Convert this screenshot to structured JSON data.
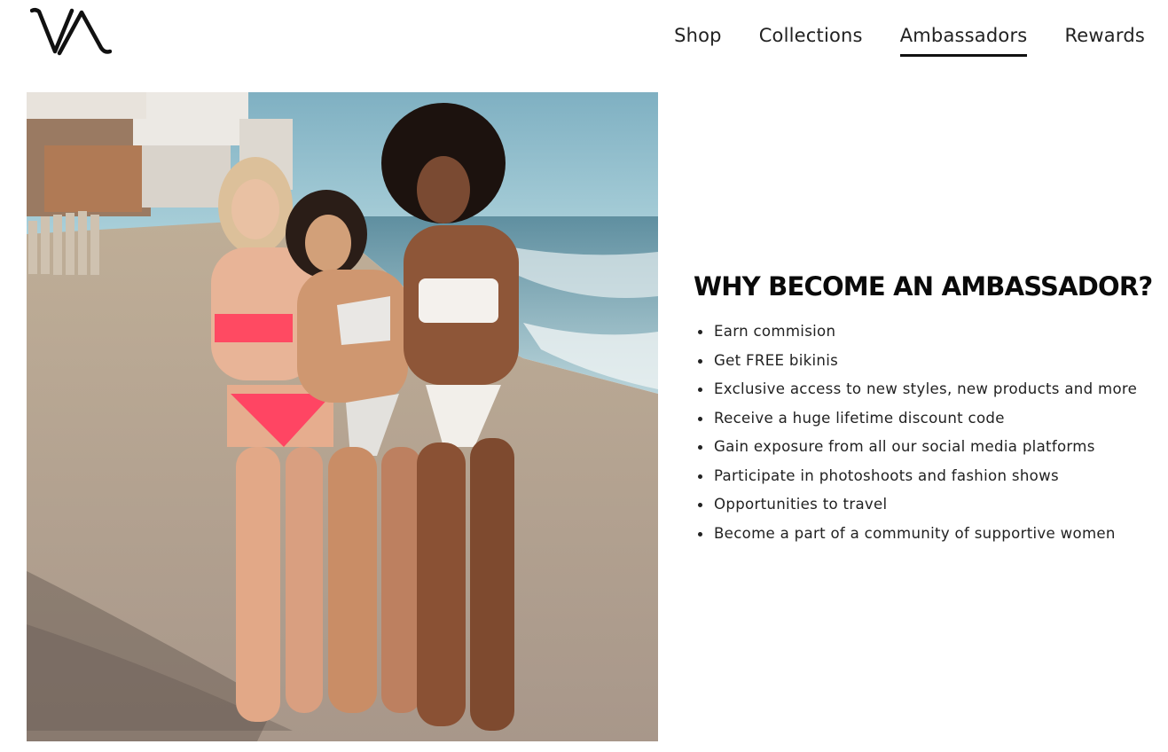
{
  "brand": {
    "logo_text": "VA"
  },
  "nav": {
    "items": [
      {
        "label": "Shop",
        "active": false
      },
      {
        "label": "Collections",
        "active": false
      },
      {
        "label": "Ambassadors",
        "active": true
      },
      {
        "label": "Rewards",
        "active": false
      }
    ]
  },
  "hero": {
    "image_subject": "beach-photo"
  },
  "main": {
    "heading": "WHY BECOME AN AMBASSADOR?",
    "benefits": [
      "Earn commision",
      "Get FREE bikinis",
      "Exclusive access to new styles, new products and more",
      "Receive a huge lifetime discount code",
      "Gain exposure from all our social media platforms",
      "Participate in photoshoots and fashion shows",
      "Opportunities to travel",
      "Become a part of a community of supportive women"
    ]
  },
  "colors": {
    "text": "#111111",
    "background": "#ffffff",
    "accent_underline": "#111111"
  }
}
